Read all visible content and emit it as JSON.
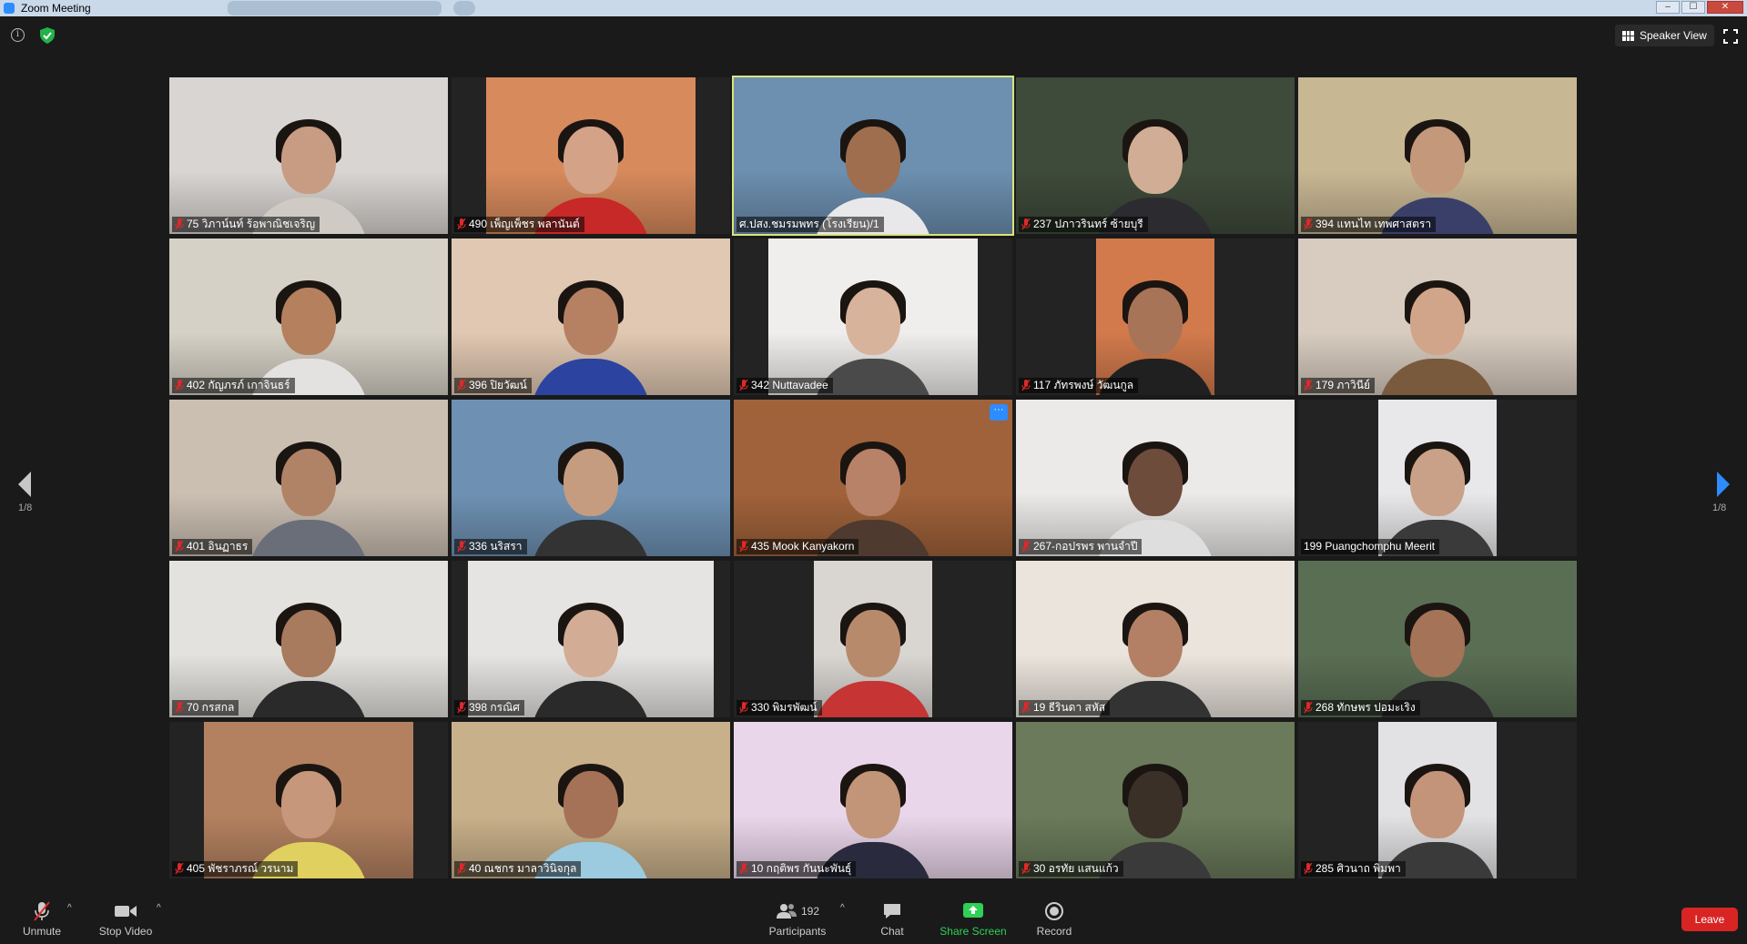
{
  "window": {
    "title": "Zoom Meeting",
    "buttons": [
      "–",
      "☐",
      "✕"
    ]
  },
  "topbar": {
    "info_icon": "info-icon",
    "security_icon": "shield-check-icon",
    "speaker_view_label": "Speaker View",
    "fullscreen_icon": "fullscreen-icon"
  },
  "pagination": {
    "left": "1/8",
    "right": "1/8"
  },
  "participants": [
    {
      "name": "75 วิภาน์นท์ ร้อพาณิชเจริญ",
      "muted": true,
      "bg": "#d9d5d2",
      "skin": "#c79c83",
      "shirt": "#cfcac4",
      "video_w": 306
    },
    {
      "name": "490 เพ็ญเพ็ชร พลานันต์",
      "muted": true,
      "bg": "#d78a5c",
      "skin": "#d3a287",
      "shirt": "#c72828",
      "video_w": 230,
      "video_l": 38
    },
    {
      "name": "ศ.ปสง.ชมรมพทร (โรงเรียน)/1",
      "muted": false,
      "bg": "#6d8fb0",
      "skin": "#9e6e4f",
      "shirt": "#e8e8ea",
      "video_w": 306,
      "active": true
    },
    {
      "name": "237 ปภาวรินทร์ ซ้ายบุรี",
      "muted": true,
      "bg": "#3e4a3a",
      "skin": "#d2ad96",
      "shirt": "#2c2c30",
      "video_w": 306
    },
    {
      "name": "394 แทนไท เทพศาสตรา",
      "muted": true,
      "bg": "#c8b793",
      "skin": "#c4987b",
      "shirt": "#3a3f6a",
      "video_w": 306
    },
    {
      "name": "402 กัญภรภ์ เกาจินธร์",
      "muted": true,
      "bg": "#d6d1c6",
      "skin": "#b5805e",
      "shirt": "#e4e2e0",
      "video_w": 306
    },
    {
      "name": "396 ปิยวัฒน์",
      "muted": true,
      "bg": "#e1c8b2",
      "skin": "#b58162",
      "shirt": "#2c44a0",
      "video_w": 306
    },
    {
      "name": "342 Nuttavadee",
      "muted": true,
      "bg": "#f0eeec",
      "skin": "#d8b39c",
      "shirt": "#4a4a4a",
      "video_w": 230,
      "video_l": 38
    },
    {
      "name": "117 ภัทรพงษ์ วัฒนกูล",
      "muted": true,
      "bg": "#d27a4c",
      "skin": "#a87458",
      "shirt": "#202020",
      "video_w": 130,
      "video_l": 88
    },
    {
      "name": "179 ภาวินีย์",
      "muted": true,
      "bg": "#d8ccc0",
      "skin": "#d1a58a",
      "shirt": "#7a5a3c",
      "video_w": 306
    },
    {
      "name": "401 อินฏาธร",
      "muted": true,
      "bg": "#cbbfb2",
      "skin": "#b08266",
      "shirt": "#6a6e78",
      "video_w": 306
    },
    {
      "name": "336 นริสรา",
      "muted": true,
      "bg": "#6e91b3",
      "skin": "#c69c80",
      "shirt": "#333",
      "video_w": 306
    },
    {
      "name": "435 Mook Kanyakorn",
      "muted": true,
      "bg": "#a0623a",
      "skin": "#b88268",
      "shirt": "#4e3a2e",
      "video_w": 306,
      "more": true
    },
    {
      "name": "267-กอปรพร พานจำปี",
      "muted": true,
      "bg": "#eceae8",
      "skin": "#6e4c3c",
      "shirt": "#dedede",
      "video_w": 306
    },
    {
      "name": "199 Puangchomphu Meerit",
      "muted": false,
      "bg": "#e8e8ea",
      "skin": "#c9a188",
      "shirt": "#3a3a3a",
      "video_w": 130,
      "video_l": 88
    },
    {
      "name": "70 กรสกล",
      "muted": true,
      "bg": "#e4e2de",
      "skin": "#a87a5e",
      "shirt": "#2a2a2a",
      "video_w": 306
    },
    {
      "name": "398 กรณิศ",
      "muted": true,
      "bg": "#e6e4e2",
      "skin": "#d2ac94",
      "shirt": "#2a2a2a",
      "video_w": 270,
      "video_l": 18
    },
    {
      "name": "330 พิมรพัฒน์",
      "muted": true,
      "bg": "#d9d6d2",
      "skin": "#b88a6c",
      "shirt": "#c63434",
      "video_w": 130,
      "video_l": 88
    },
    {
      "name": "19 ธีรินดา สหัส",
      "muted": true,
      "bg": "#eae4dc",
      "skin": "#b38066",
      "shirt": "#333",
      "video_w": 306
    },
    {
      "name": "268 ทักษพร ปอมะเริง",
      "muted": true,
      "bg": "#5a6e54",
      "skin": "#a57358",
      "shirt": "#2a2a2a",
      "video_w": 306
    },
    {
      "name": "405 พัชราภรณ์ วรนาม",
      "muted": true,
      "bg": "#b38160",
      "skin": "#c6977a",
      "shirt": "#e0d060",
      "video_w": 230,
      "video_l": 38
    },
    {
      "name": "40 ณชกร มาลาวินิจกุล",
      "muted": true,
      "bg": "#c8b08a",
      "skin": "#a57258",
      "shirt": "#9ccbe0",
      "video_w": 306
    },
    {
      "name": "10 กฤติพร กันนะพันธุ์",
      "muted": true,
      "bg": "#ead6ea",
      "skin": "#c29478",
      "shirt": "#2a2a3e",
      "video_w": 306
    },
    {
      "name": "30 อรทัย แสนแก้ว",
      "muted": true,
      "bg": "#6a7a5a",
      "skin": "#3a3028",
      "shirt": "#3a3a3a",
      "video_w": 306
    },
    {
      "name": "285 ศิวนาถ พิมพา",
      "muted": true,
      "bg": "#e2e2e4",
      "skin": "#c39479",
      "shirt": "#3a3a3a",
      "video_w": 130,
      "video_l": 88
    }
  ],
  "toolbar": {
    "unmute_label": "Unmute",
    "stop_video_label": "Stop Video",
    "participants_label": "Participants",
    "participants_count": "192",
    "chat_label": "Chat",
    "share_screen_label": "Share Screen",
    "record_label": "Record",
    "leave_label": "Leave"
  },
  "colors": {
    "accent": "#2d8cff",
    "share_green": "#2ed055",
    "leave_red": "#d92424",
    "active_speaker": "#d9e57a"
  }
}
